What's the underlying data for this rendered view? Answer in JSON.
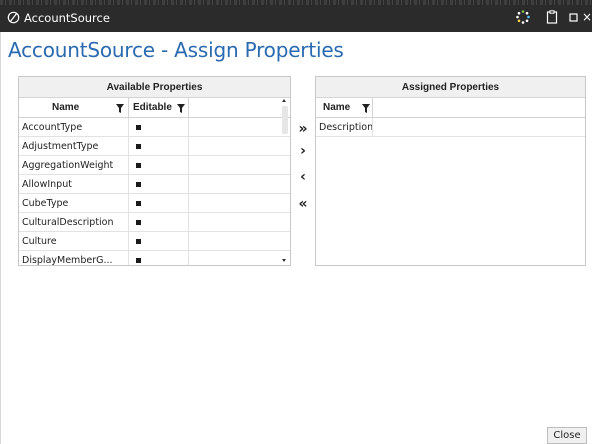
{
  "window": {
    "title": "AccountSource",
    "controls": [
      "spinner-icon",
      "clipboard-icon",
      "maximize-icon",
      "close-icon"
    ],
    "close_glyph": "×"
  },
  "page": {
    "title": "AccountSource - Assign Properties",
    "accent_color": "#2a6ab1"
  },
  "available": {
    "header": "Available Properties",
    "columns": {
      "name": "Name",
      "editable": "Editable"
    },
    "rows": [
      {
        "name": "AccountType",
        "editable": true
      },
      {
        "name": "AdjustmentType",
        "editable": true
      },
      {
        "name": "AggregationWeight",
        "editable": true
      },
      {
        "name": "AllowInput",
        "editable": true
      },
      {
        "name": "CubeType",
        "editable": true
      },
      {
        "name": "CulturalDescription",
        "editable": true
      },
      {
        "name": "Culture",
        "editable": true
      },
      {
        "name": "DisplayMemberG...",
        "editable": true
      }
    ]
  },
  "transfer": {
    "assign_all": "»",
    "assign_one": "›",
    "unassign_one": "‹",
    "unassign_all": "«"
  },
  "assigned": {
    "header": "Assigned Properties",
    "columns": {
      "name": "Name"
    },
    "rows": [
      {
        "name": "Description"
      }
    ]
  },
  "footer": {
    "close_label": "Close"
  }
}
